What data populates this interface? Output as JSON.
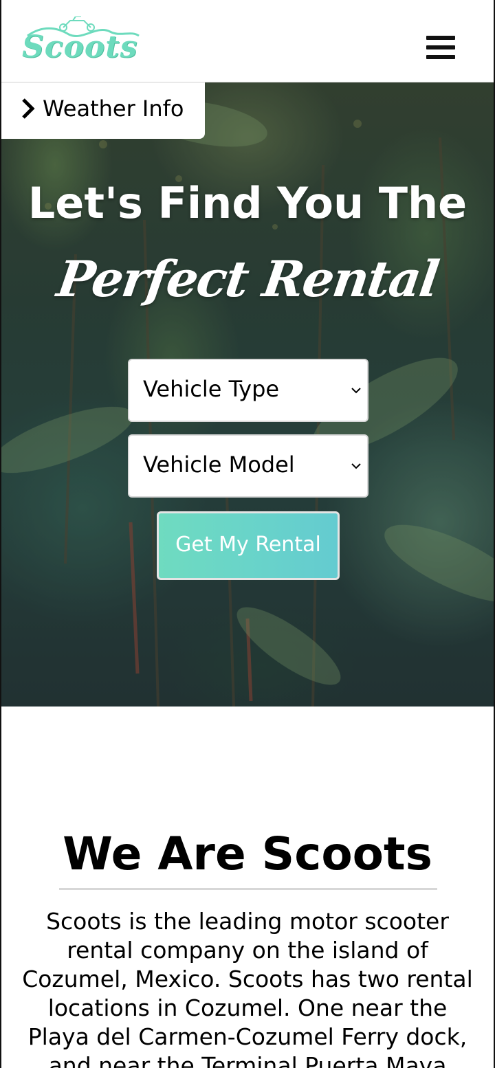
{
  "header": {
    "logo_text": "Scoots",
    "menu_icon": "hamburger-menu-icon"
  },
  "weather_tab": {
    "icon": "chevron-right-icon",
    "label": "Weather Info"
  },
  "hero": {
    "headline": "Let's Find You The",
    "headline_script": "Perfect Rental",
    "vehicle_type": {
      "selected": "Vehicle Type",
      "icon": "chevron-down-icon"
    },
    "vehicle_model": {
      "selected": "Vehicle Model",
      "icon": "chevron-down-icon"
    },
    "cta_label": "Get My Rental"
  },
  "about": {
    "title": "We Are Scoots",
    "text": "Scoots is the leading motor scooter rental company on the island of Cozumel, Mexico. Scoots has two rental locations in Cozumel. One near the Playa del Carmen-Cozumel Ferry dock, and near the Terminal Puerta Maya"
  },
  "colors": {
    "brand_teal": "#6ddbbd",
    "cta_gradient_start": "#6fdbc0",
    "cta_gradient_end": "#64cbd0",
    "text": "#000000",
    "header_bg": "#ffffff"
  }
}
